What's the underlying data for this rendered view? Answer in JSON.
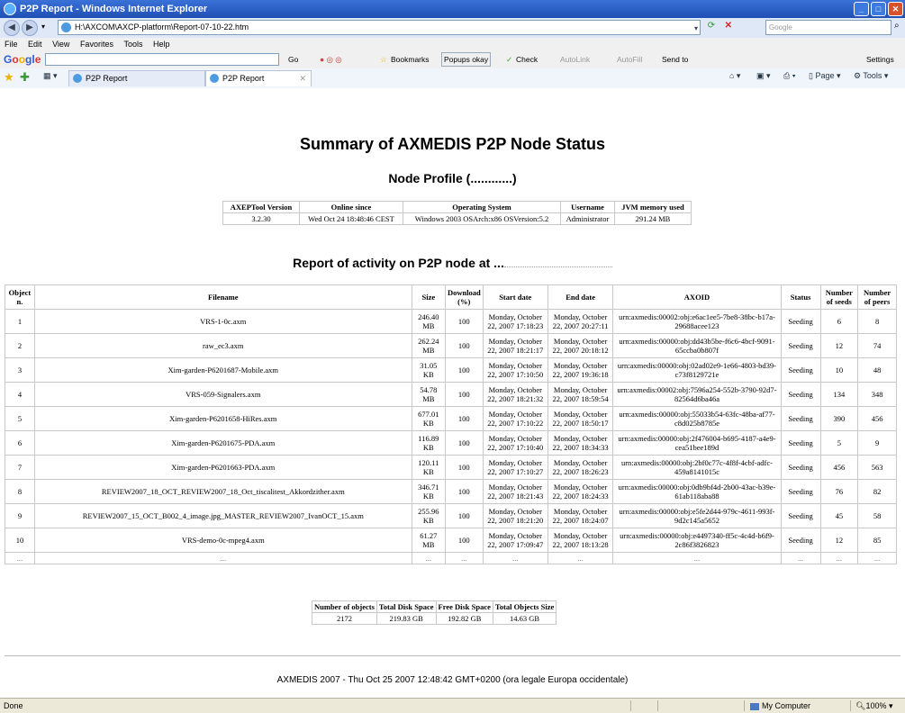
{
  "window": {
    "title": "P2P Report - Windows Internet Explorer"
  },
  "address": {
    "url": "H:\\AXCOM\\AXCP-platform\\Report-07-10-22.htm",
    "search_placeholder": "Google"
  },
  "menu": [
    "File",
    "Edit",
    "View",
    "Favorites",
    "Tools",
    "Help"
  ],
  "google_toolbar": {
    "go": "Go",
    "bookmarks": "Bookmarks",
    "popups": "Popups okay",
    "check": "Check",
    "autolink": "AutoLink",
    "autofill": "AutoFill",
    "send_to": "Send to",
    "settings": "Settings"
  },
  "tabs": [
    {
      "label": "P2P Report"
    },
    {
      "label": "P2P Report"
    }
  ],
  "tab_tools": {
    "page": "Page",
    "tools": "Tools"
  },
  "report": {
    "title": "Summary of AXMEDIS P2P Node Status",
    "profile_heading": "Node Profile (............)",
    "profile_headers": [
      "AXEPTool Version",
      "Online since",
      "Operating System",
      "Username",
      "JVM memory used"
    ],
    "profile_values": [
      "3.2.30",
      "Wed Oct 24 18:48:46 CEST",
      "Windows 2003 OSArch:x86 OSVersion:5.2",
      "Administrator",
      "291.24 MB"
    ],
    "activity_heading": "Report of activity on P2P node at ...",
    "activity_headers": [
      "Object n.",
      "Filename",
      "Size",
      "Download (%)",
      "Start date",
      "End date",
      "AXOID",
      "Status",
      "Number of seeds",
      "Number of peers"
    ],
    "rows": [
      [
        "1",
        "VRS-1-0c.axm",
        "246.40 MB",
        "100",
        "Monday, October 22, 2007 17:18:23",
        "Monday, October 22, 2007 20:27:11",
        "urn:axmedis:00002:obj:e6ac1ee5-7be8-38bc-b17a-29688acee123",
        "Seeding",
        "6",
        "8"
      ],
      [
        "2",
        "raw_ec3.axm",
        "262.24 MB",
        "100",
        "Monday, October 22, 2007 18:21:17",
        "Monday, October 22, 2007 20:18:12",
        "urn:axmedis:00000:obj:dd43b5be-f6c6-4bcf-9091-65ccba0b807f",
        "Seeding",
        "12",
        "74"
      ],
      [
        "3",
        "Xim-garden-P6201687-Mobile.axm",
        "31.05 KB",
        "100",
        "Monday, October 22, 2007 17:10:50",
        "Monday, October 22, 2007 19:36:18",
        "urn:axmedis:00000:obj:02ad02e9-1e66-4803-bd39-c73f8129721e",
        "Seeding",
        "10",
        "48"
      ],
      [
        "4",
        "VRS-059-Signalers.axm",
        "54.78 MB",
        "100",
        "Monday, October 22, 2007 18:21:32",
        "Monday, October 22, 2007 18:59:54",
        "urn:axmedis:00002:obj:7596a254-552b-3790-92d7-82564d6ba46a",
        "Seeding",
        "134",
        "348"
      ],
      [
        "5",
        "Xim-garden-P6201658-HiRes.axm",
        "677.01 KB",
        "100",
        "Monday, October 22, 2007 17:10:22",
        "Monday, October 22, 2007 18:50:17",
        "urn:axmedis:00000:obj:55033b54-63fc-48ba-af77-c8d025b8785e",
        "Seeding",
        "390",
        "456"
      ],
      [
        "6",
        "Xim-garden-P6201675-PDA.axm",
        "116.89 KB",
        "100",
        "Monday, October 22, 2007 17:10:40",
        "Monday, October 22, 2007 18:34:33",
        "urn:axmedis:00000:obj:2f476004-b695-4187-a4e9-cea51bee189d",
        "Seeding",
        "5",
        "9"
      ],
      [
        "7",
        "Xim-garden-P6201663-PDA.axm",
        "120.11 KB",
        "100",
        "Monday, October 22, 2007 17:10:27",
        "Monday, October 22, 2007 18:26:23",
        "urn:axmedis:00000:obj:2bf0c77c-4f8f-4cbf-adfc-459a8141015c",
        "Seeding",
        "456",
        "563"
      ],
      [
        "8",
        "REVIEW2007_18_OCT_REVIEW2007_18_Oct_tiscalitest_Akkordzither.axm",
        "346.71 KB",
        "100",
        "Monday, October 22, 2007 18:21:43",
        "Monday, October 22, 2007 18:24:33",
        "urn:axmedis:00000:obj:0db9bf4d-2b00-43ac-b39e-61ab118aba88",
        "Seeding",
        "76",
        "82"
      ],
      [
        "9",
        "REVIEW2007_15_OCT_B002_4_image.jpg_MASTER_REVIEW2007_IvanOCT_15.axm",
        "255.96 KB",
        "100",
        "Monday, October 22, 2007 18:21:20",
        "Monday, October 22, 2007 18:24:07",
        "urn:axmedis:00000:obj:e5fe2d44-979c-4611-993f-9d2c145a5652",
        "Seeding",
        "45",
        "58"
      ],
      [
        "10",
        "VRS-demo-0c-mpeg4.axm",
        "61.27 MB",
        "100",
        "Monday, October 22, 2007 17:09:47",
        "Monday, October 22, 2007 18:13:28",
        "urn:axmedis:00000:obj:e4497340-ff5c-4c4d-b6f9-2c86f3826823",
        "Seeding",
        "12",
        "85"
      ]
    ],
    "ellipsis": "...",
    "summary_headers": [
      "Number of objects",
      "Total Disk Space",
      "Free Disk Space",
      "Total Objects Size"
    ],
    "summary_values": [
      "2172",
      "219.83 GB",
      "192.82 GB",
      "14.63 GB"
    ],
    "footer": "AXMEDIS 2007 - Thu Oct 25 2007 12:48:42 GMT+0200 (ora legale Europa occidentale)"
  },
  "status": {
    "left": "Done",
    "zone": "My Computer",
    "zoom": "100%"
  },
  "colors": {
    "titlebar": "#1f4fb4",
    "statusbar": "#ece9d8"
  }
}
